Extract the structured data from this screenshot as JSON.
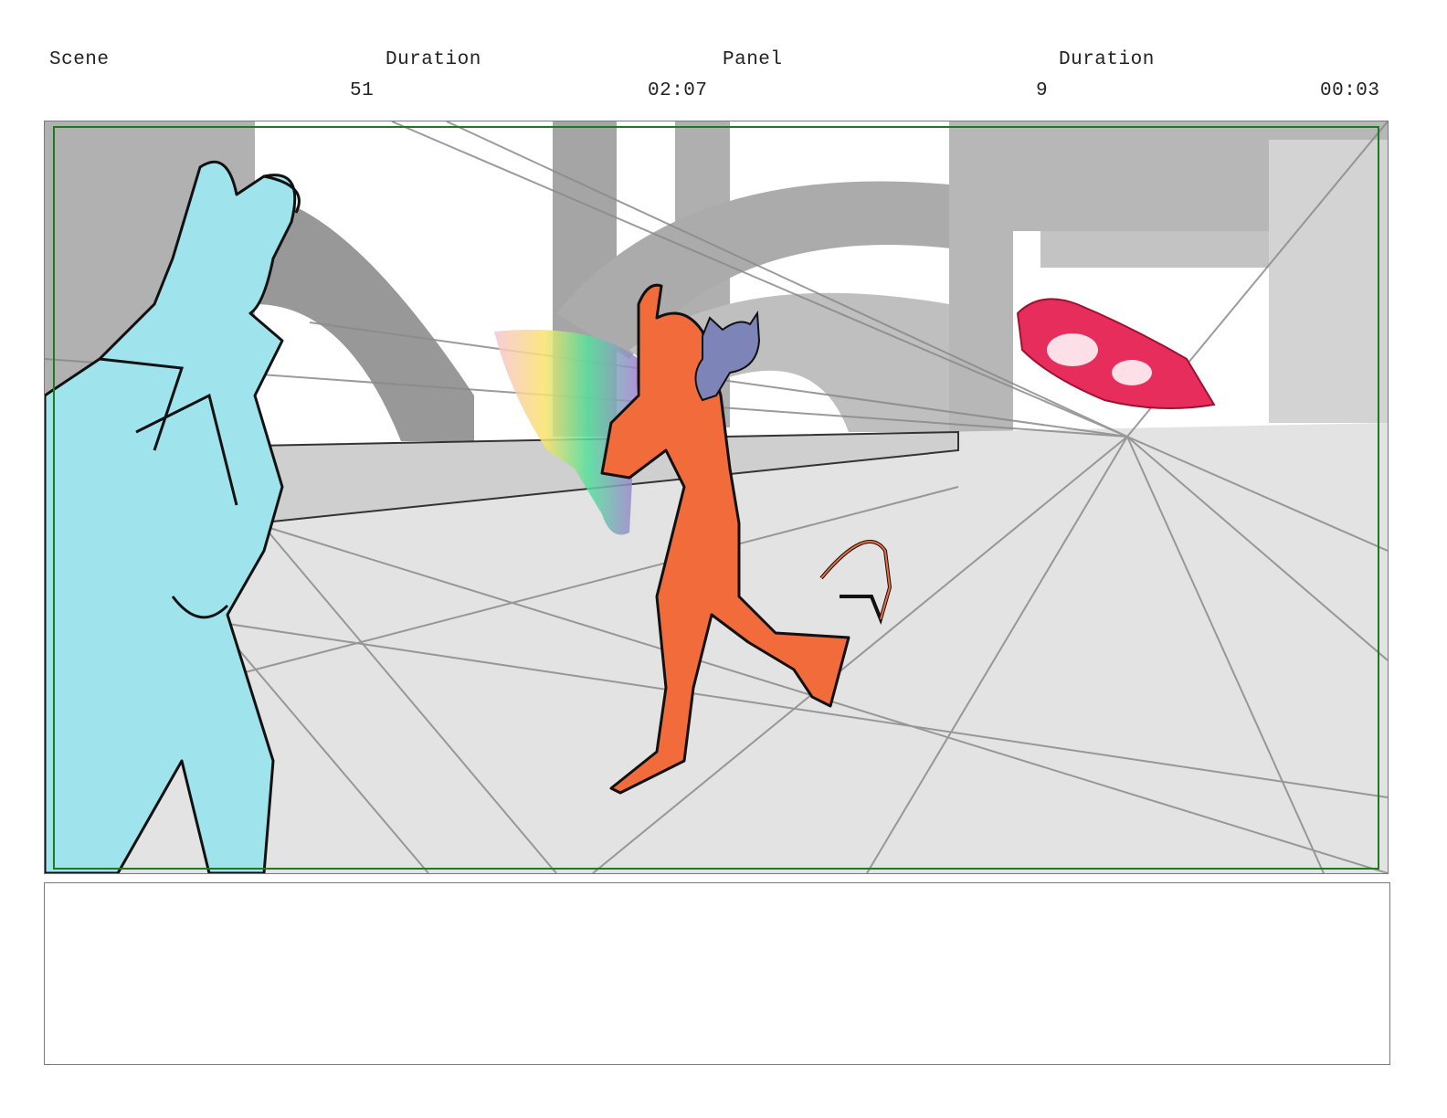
{
  "header": {
    "scene_label": "Scene",
    "scene_duration_label": "Duration",
    "panel_label": "Panel",
    "panel_duration_label": "Duration",
    "scene_value": "51",
    "scene_duration_value": "02:07",
    "panel_value": "9",
    "panel_duration_value": "00:03"
  },
  "panel": {
    "safe_frame_color": "#1f7a1f",
    "characters": [
      {
        "name": "cyan-demon",
        "color": "#9fe3ec"
      },
      {
        "name": "orange-demon",
        "color": "#f26b3a"
      },
      {
        "name": "blue-cat",
        "color": "#7d84b7"
      }
    ],
    "effects": [
      {
        "name": "rainbow-shield",
        "colors": [
          "#f7c3d4",
          "#f9e36b",
          "#54e19c",
          "#a37bd1"
        ]
      },
      {
        "name": "red-projectile",
        "color": "#e72d5c"
      }
    ]
  },
  "notes": {}
}
